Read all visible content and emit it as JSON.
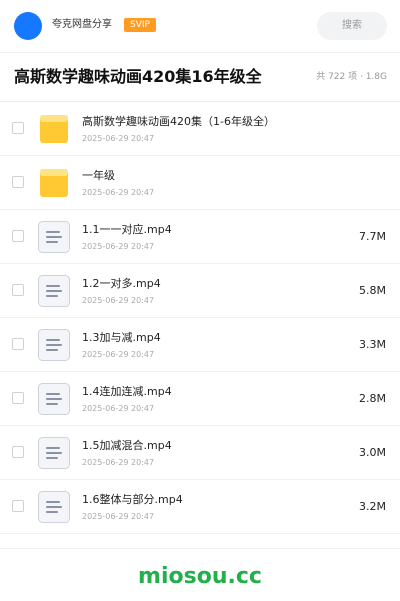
{
  "header": {
    "share_name": "夸克网盘分享",
    "badge": "SVIP",
    "search_label": "搜索"
  },
  "folder": {
    "title": "高斯数学趣味动画420集16年级全",
    "summary": "共 722 项 · 1.8G"
  },
  "files": [
    {
      "type": "folder",
      "name": "高斯数学趣味动画420集（1-6年级全）",
      "date": "2025-06-29 20:47",
      "size": ""
    },
    {
      "type": "folder",
      "name": "一年级",
      "date": "2025-06-29 20:47",
      "size": ""
    },
    {
      "type": "video",
      "name": "1.1一一对应.mp4",
      "date": "2025-06-29 20:47",
      "size": "7.7M"
    },
    {
      "type": "video",
      "name": "1.2一对多.mp4",
      "date": "2025-06-29 20:47",
      "size": "5.8M"
    },
    {
      "type": "video",
      "name": "1.3加与减.mp4",
      "date": "2025-06-29 20:47",
      "size": "3.3M"
    },
    {
      "type": "video",
      "name": "1.4连加连减.mp4",
      "date": "2025-06-29 20:47",
      "size": "2.8M"
    },
    {
      "type": "video",
      "name": "1.5加减混合.mp4",
      "date": "2025-06-29 20:47",
      "size": "3.0M"
    },
    {
      "type": "video",
      "name": "1.6整体与部分.mp4",
      "date": "2025-06-29 20:47",
      "size": "3.2M"
    }
  ],
  "watermark": "miosou.cc",
  "colors": {
    "avatar": "#1677ff",
    "svip_badge": "#ff9b21",
    "folder": "#ffc933",
    "watermark": "#22b04b"
  }
}
